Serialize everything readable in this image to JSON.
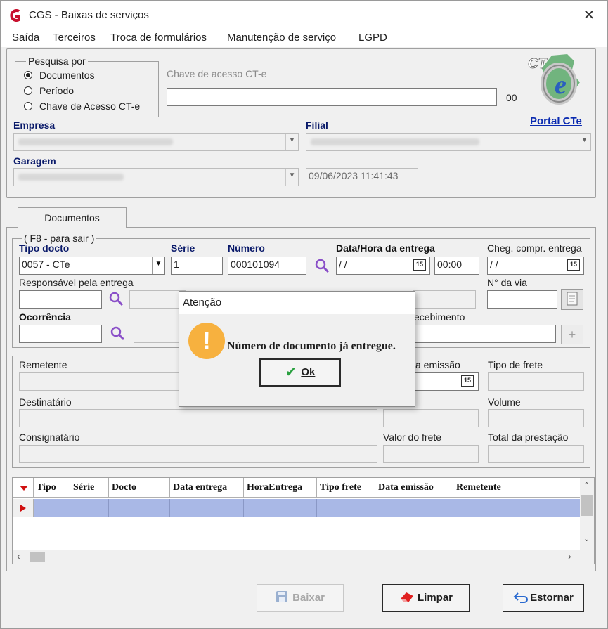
{
  "window": {
    "title": "CGS - Baixas de serviços",
    "close_glyph": "✕"
  },
  "menu": [
    "Saída",
    "Terceiros",
    "Troca de formulários",
    "Manutenção de serviço",
    "LGPD"
  ],
  "search": {
    "legend": "Pesquisa por",
    "options": [
      "Documentos",
      "Período",
      "Chave de Acesso CT-e"
    ],
    "selected": "Documentos",
    "access_key_label": "Chave de acesso CT-e",
    "access_key_value": "",
    "access_key_suffix": "00"
  },
  "header": {
    "empresa_label": "Empresa",
    "filial_label": "Filial",
    "garagem_label": "Garagem",
    "datetime": "09/06/2023 11:41:43",
    "portal_link": "Portal CTe",
    "logo_text": "CT e"
  },
  "tabs": [
    "Documentos"
  ],
  "doc": {
    "hint": "( F8 - para sair )",
    "tipo_label": "Tipo docto",
    "tipo_value": "0057 - CTe",
    "serie_label": "Série",
    "serie_value": "1",
    "numero_label": "Número",
    "numero_value": "000101094",
    "data_label": "Data/Hora da entrega",
    "data_value": " / /",
    "hora_value": "00:00",
    "cheg_label": "Cheg. compr. entrega",
    "cheg_value": " / /",
    "resp_label": "Responsável pela entrega",
    "via_label": "N° da via",
    "ocorrencia_label": "Ocorrência",
    "recebimento_label": "ecebimento",
    "cal_glyph": "15",
    "plus_glyph": "+"
  },
  "details": {
    "remetente": "Remetente",
    "emissao": "a emissão",
    "tipo_frete": "Tipo de frete",
    "destinatario": "Destinatário",
    "volume": "Volume",
    "consignatario": "Consignatário",
    "valor_frete": "Valor do frete",
    "total_prestacao": "Total da prestação"
  },
  "grid": {
    "columns": [
      "Tipo",
      "Série",
      "Docto",
      "Data entrega",
      "HoraEntrega",
      "Tipo frete",
      "Data emissão",
      "Remetente"
    ]
  },
  "buttons": {
    "baixar": "Baixar",
    "limpar": "Limpar",
    "estornar": "Estornar"
  },
  "dialog": {
    "title": "Atenção",
    "icon": "!",
    "message": "Número de documento já entregue.",
    "ok": "Ok"
  }
}
